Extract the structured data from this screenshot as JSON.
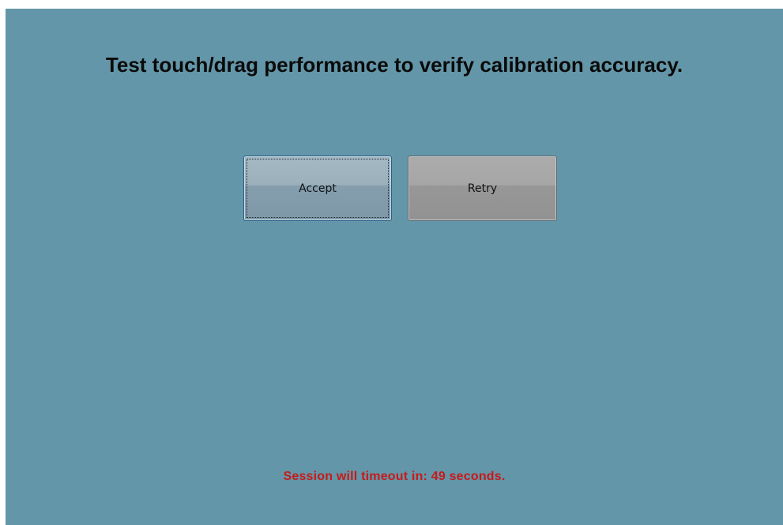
{
  "colors": {
    "background": "#6396a8",
    "timeout_text": "#c71a1a",
    "instruction_text": "#0a0a0a"
  },
  "instruction": "Test touch/drag performance to verify calibration accuracy.",
  "buttons": {
    "accept_label": "Accept",
    "retry_label": "Retry"
  },
  "timeout": {
    "prefix": "Session will timeout in: ",
    "seconds": "49",
    "suffix": " seconds."
  }
}
